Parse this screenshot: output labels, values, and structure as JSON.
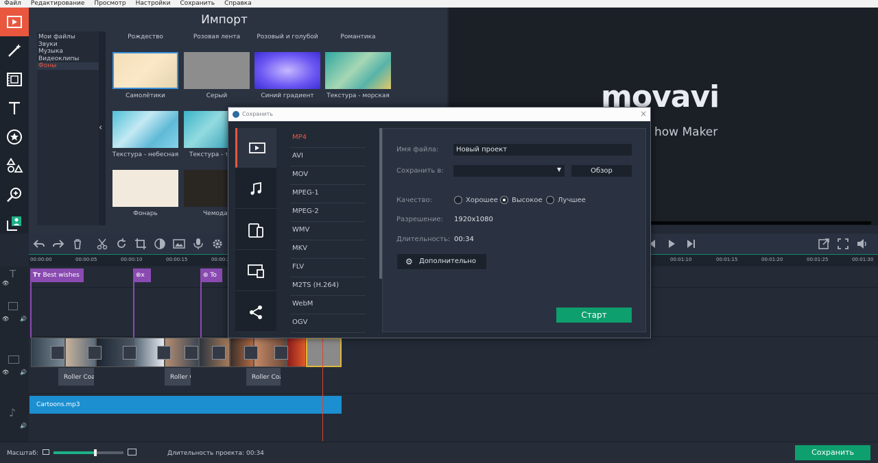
{
  "menu": [
    "Файл",
    "Редактирование",
    "Просмотр",
    "Настройки",
    "Сохранить",
    "Справка"
  ],
  "left_tools": [
    "film-import-icon",
    "magic-wand-icon",
    "film-filter-icon",
    "text-icon",
    "sticker-icon",
    "shapes-icon",
    "zoom-icon",
    "chroma-key-icon"
  ],
  "import": {
    "title": "Импорт",
    "categories": [
      "Мои файлы",
      "Звуки",
      "Музыка",
      "Видеоклипы",
      "Фоны"
    ],
    "selected_category": "Фоны",
    "columns": [
      "Рождество",
      "Розовая лента",
      "Розовый и голубой",
      "Романтика"
    ],
    "thumbs": [
      "Самолётики",
      "Серый",
      "Синий градиент",
      "Текстура - морская",
      "Текстура - небесная",
      "Текстура - т",
      "Фонарь",
      "Чемодан"
    ]
  },
  "preview": {
    "logo": "movavi",
    "subtitle": "how Maker"
  },
  "ruler": [
    "00:00:00",
    "00:00:05",
    "00:00:10",
    "00:00:15",
    "00:00:20",
    "00:01:10",
    "00:01:15",
    "00:01:20",
    "00:01:25",
    "00:01:30"
  ],
  "timeline": {
    "text_clip": "Best wishes",
    "text_clip_2": "x",
    "text_clip_3": "To",
    "roller_clips": [
      "Roller Coa",
      "Roller C",
      "Roller Coa"
    ],
    "audio_clip": "Cartoons.mp3"
  },
  "bottom": {
    "scale_label": "Масштаб:",
    "zoom_level": 0.6,
    "duration_label": "Длительность проекта:",
    "duration_value": "00:34",
    "save_button": "Сохранить"
  },
  "dialog": {
    "title": "Сохранить",
    "tabs": [
      "video-icon",
      "music-icon",
      "devices-icon",
      "tv-icon",
      "share-icon"
    ],
    "formats": [
      "MP4",
      "AVI",
      "MOV",
      "MPEG-1",
      "MPEG-2",
      "WMV",
      "MKV",
      "FLV",
      "M2TS (H.264)",
      "WebM",
      "OGV"
    ],
    "selected_format": "MP4",
    "filename_label": "Имя файла:",
    "filename_value": "Новый проект",
    "savein_label": "Сохранить в:",
    "browse_button": "Обзор",
    "quality_label": "Качество:",
    "quality_options": [
      "Хорошее",
      "Высокое",
      "Лучшее"
    ],
    "quality_selected": "Высокое",
    "resolution_label": "Разрешение:",
    "resolution_value": "1920x1080",
    "duration_label": "Длительность:",
    "duration_value": "00:34",
    "advanced_button": "Дополнительно",
    "start_button": "Старт"
  },
  "colors": {
    "accent": "#e9573f",
    "green": "#0e9f6e",
    "title_clip": "#8a4bb1",
    "audio_clip": "#1b8fd0"
  }
}
